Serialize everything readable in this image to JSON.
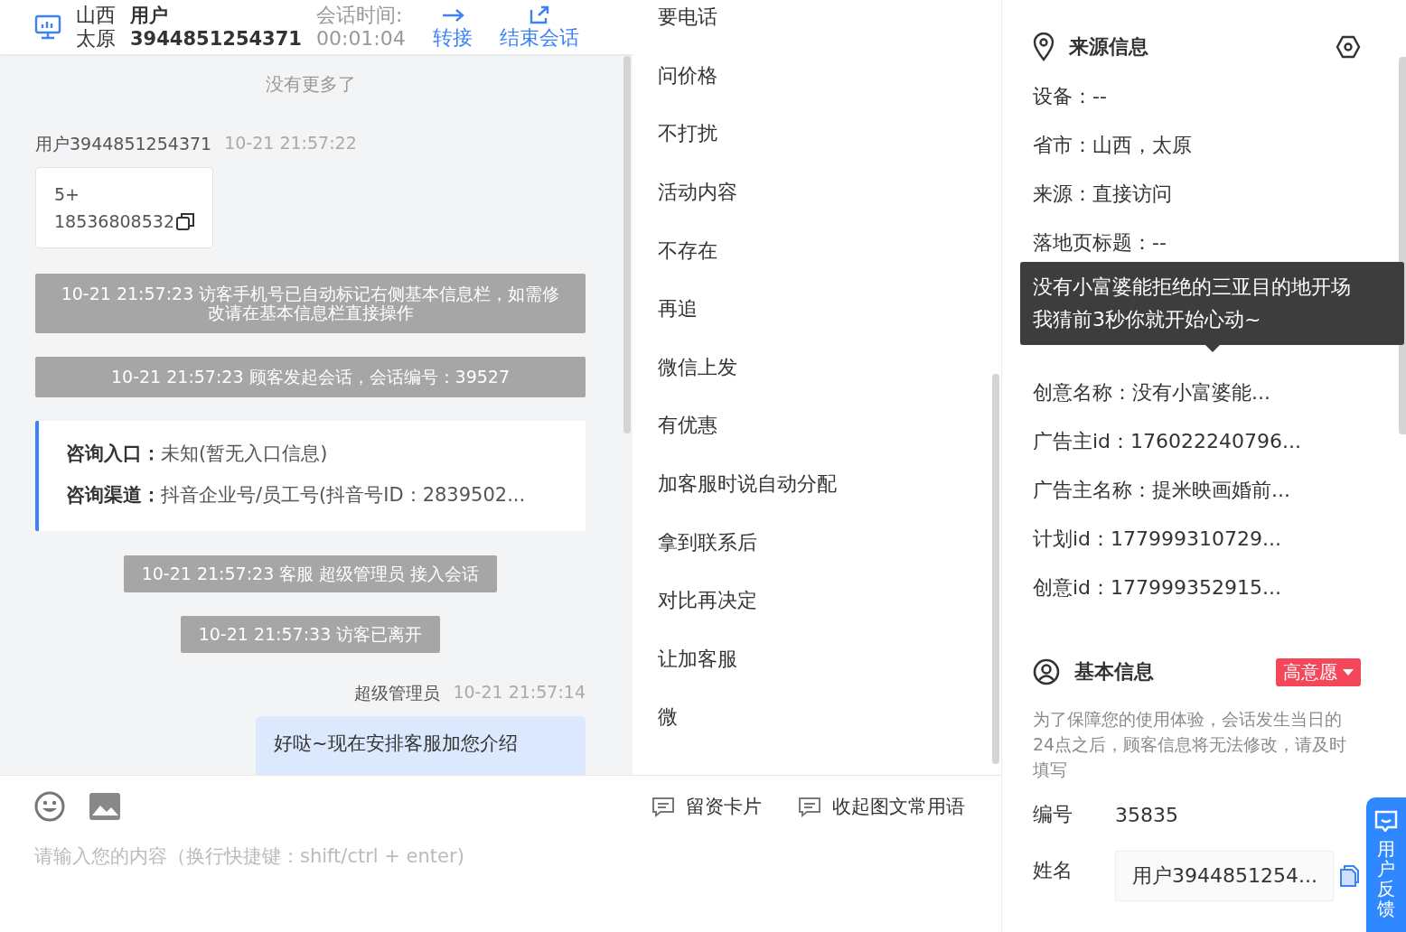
{
  "header": {
    "region": [
      "山西",
      "太原"
    ],
    "user_label": "用户",
    "user_id": "3944851254371",
    "time_label": "会话时间:",
    "time": "00:01:04",
    "actions": [
      {
        "label": "转接",
        "kind": "transfer"
      },
      {
        "label": "结束会话",
        "kind": "end"
      }
    ]
  },
  "chat": {
    "no_more": "没有更多了",
    "messages": [
      {
        "kind": "visitor",
        "sender": "用户3944851254371",
        "time": "10-21 21:57:22",
        "lines": [
          "5+",
          "18536808532"
        ]
      },
      {
        "kind": "system",
        "text": "10-21 21:57:23 访客手机号已自动标记右侧基本信息栏，如需修改请在基本信息栏直接操作"
      },
      {
        "kind": "system",
        "text": "10-21 21:57:23 顾客发起会话，会话编号：39527"
      },
      {
        "kind": "info",
        "rows": [
          {
            "label": "咨询入口：",
            "value": "未知(暂无入口信息)"
          },
          {
            "label": "咨询渠道：",
            "value": "抖音企业号/员工号(抖音号ID：2839502..."
          }
        ]
      },
      {
        "kind": "system",
        "text": "10-21 21:57:23 客服 超级管理员 接入会话"
      },
      {
        "kind": "system",
        "text": "10-21 21:57:33 访客已离开"
      },
      {
        "kind": "agent",
        "sender": "超级管理员",
        "time": "10-21 21:57:14",
        "lines": [
          "好哒~现在安排客服加您介绍"
        ]
      }
    ]
  },
  "phrases": [
    "要电话",
    "问价格",
    "不打扰",
    "活动内容",
    "不存在",
    "再追",
    "微信上发",
    "有优惠",
    "加客服时说自动分配",
    "拿到联系后",
    "对比再决定",
    "让加客服",
    "微"
  ],
  "composer": {
    "tools": [
      {
        "label": "留资卡片"
      },
      {
        "label": "收起图文常用语"
      }
    ],
    "placeholder": "请输入您的内容（换行快捷键：shift/ctrl + enter)"
  },
  "source_info": {
    "title": "来源信息",
    "fields": [
      "设备：--",
      "省市：山西，太原",
      "来源：直接访问",
      "落地页标题：--"
    ],
    "tooltip": [
      "没有小富婆能拒绝的三亚目的地开场",
      "我猜前3秒你就开始心动~"
    ],
    "more_fields": [
      "创意名称：没有小富婆能...",
      "广告主id：176022240796...",
      "广告主名称：提米映画婚前...",
      "计划id：177999310729...",
      "创意id：177999352915..."
    ]
  },
  "basic_info": {
    "title": "基本信息",
    "intent": "高意愿",
    "notice": "为了保障您的使用体验，会话发生当日的24点之后，顾客信息将无法修改，请及时填写",
    "fields": [
      {
        "label": "编号",
        "value": "35835",
        "kind": "text"
      },
      {
        "label": "姓名",
        "value": "用户3944851254...",
        "kind": "input"
      }
    ]
  },
  "feedback": "用户反馈"
}
